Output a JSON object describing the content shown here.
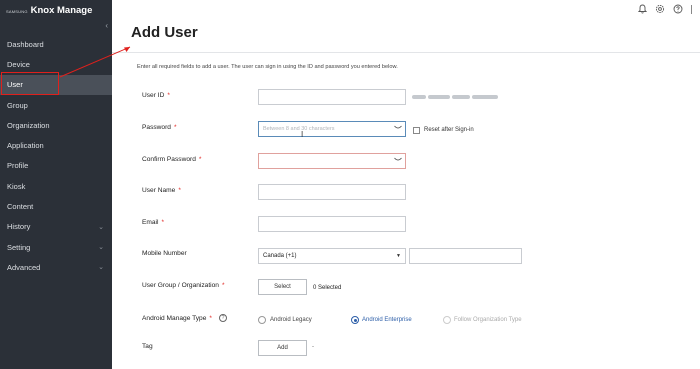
{
  "brand": {
    "small": "SAMSUNG",
    "large": "Knox Manage"
  },
  "sidebar": {
    "items": [
      {
        "label": "Dashboard",
        "chevron": ""
      },
      {
        "label": "Device",
        "chevron": ""
      },
      {
        "label": "User",
        "chevron": ""
      },
      {
        "label": "Group",
        "chevron": ""
      },
      {
        "label": "Organization",
        "chevron": ""
      },
      {
        "label": "Application",
        "chevron": ""
      },
      {
        "label": "Profile",
        "chevron": ""
      },
      {
        "label": "Kiosk",
        "chevron": ""
      },
      {
        "label": "Content",
        "chevron": ""
      },
      {
        "label": "History",
        "chevron": "⌄"
      },
      {
        "label": "Setting",
        "chevron": "⌄"
      },
      {
        "label": "Advanced",
        "chevron": "⌄"
      }
    ],
    "collapse_glyph": "‹"
  },
  "topbar": {
    "icons": [
      "bell-icon",
      "gear-icon",
      "help-icon"
    ]
  },
  "page": {
    "title": "Add User",
    "intro": "Enter all required fields to add a user. The user can sign in using the ID and password you entered below."
  },
  "form": {
    "user_id": {
      "label": "User ID",
      "required": "*",
      "value": ""
    },
    "password": {
      "label": "Password",
      "required": "*",
      "placeholder": "Between 8 and 30 characters",
      "reset_label": "Reset after Sign-in"
    },
    "confirm_password": {
      "label": "Confirm Password",
      "required": "*"
    },
    "user_name": {
      "label": "User Name",
      "required": "*"
    },
    "email": {
      "label": "Email",
      "required": "*"
    },
    "mobile": {
      "label": "Mobile Number",
      "country": "Canada (+1)"
    },
    "group": {
      "label": "User Group / Organization",
      "required": "*",
      "button": "Select",
      "selected": "0 Selected"
    },
    "manage_type": {
      "label": "Android Manage Type",
      "required": "*",
      "options": [
        "Android Legacy",
        "Android Enterprise",
        "Follow Organization Type"
      ],
      "selected": "Android Enterprise"
    },
    "tag": {
      "label": "Tag",
      "button": "Add",
      "value": "-"
    }
  },
  "colors": {
    "sidebar_bg": "#2b3038",
    "accent": "#2c5ea8",
    "required": "#e0201c"
  }
}
